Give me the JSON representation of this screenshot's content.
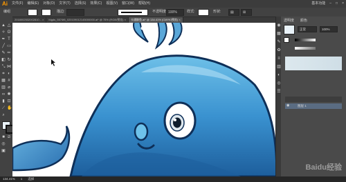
{
  "app": {
    "logo": "Ai"
  },
  "menu": [
    "文件(F)",
    "编辑(E)",
    "对象(O)",
    "文字(T)",
    "选择(S)",
    "效果(C)",
    "视图(V)",
    "窗口(W)",
    "帮助(H)"
  ],
  "window": {
    "layout_label": "基本功能"
  },
  "control_bar": {
    "object_label": "编组",
    "stroke_label": "描边:",
    "opacity_label": "不透明度:",
    "opacity_value": "100%",
    "style_label": "样式:",
    "shape_label": "形状:"
  },
  "tabs": [
    {
      "label": "2018002532002810... ×"
    },
    {
      "label": "fdgds_5574f6_020109012145000000.ai* @ 75% (RGB/预览) ×",
      "active": true
    },
    {
      "label": "卡通鲸鱼.ai* @ 134.41% (CMYK/预览) ×"
    }
  ],
  "panel": {
    "tab1": "透明度",
    "tab2": "颜色",
    "mode": "正常",
    "opacity": "100%",
    "layer_name": "图层 1"
  },
  "status": {
    "zoom": "134.41%",
    "page": "1",
    "tool_name": "选择"
  },
  "watermark": "Baidu经验",
  "colors": {
    "whale_light": "#5fb4e0",
    "whale_mid": "#2f86c8",
    "whale_dark": "#1d5e9c",
    "outline": "#0e2f58",
    "accent": "#ff9a00"
  }
}
